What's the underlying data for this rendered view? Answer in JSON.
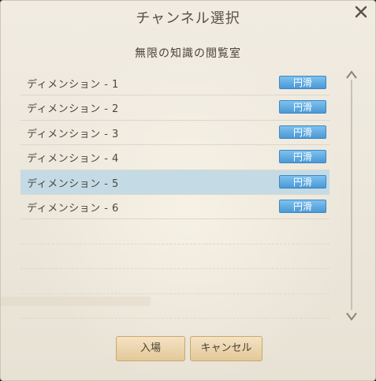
{
  "dialog": {
    "title": "チャンネル選択",
    "subtitle": "無限の知識の閲覧室"
  },
  "channels": [
    {
      "name": "ディメンション - 1",
      "status": "円滑",
      "selected": false
    },
    {
      "name": "ディメンション - 2",
      "status": "円滑",
      "selected": false
    },
    {
      "name": "ディメンション - 3",
      "status": "円滑",
      "selected": false
    },
    {
      "name": "ディメンション - 4",
      "status": "円滑",
      "selected": false
    },
    {
      "name": "ディメンション - 5",
      "status": "円滑",
      "selected": true
    },
    {
      "name": "ディメンション - 6",
      "status": "円滑",
      "selected": false
    }
  ],
  "buttons": {
    "enter": "入場",
    "cancel": "キャンセル"
  },
  "icons": {
    "close": "close-icon",
    "scroll_up": "scroll-up-arrow-icon",
    "scroll_down": "scroll-down-arrow-icon"
  },
  "colors": {
    "status_badge": "#5aa9e0",
    "selected_row": "#c4dbe6",
    "button": "#e9d2a8"
  }
}
